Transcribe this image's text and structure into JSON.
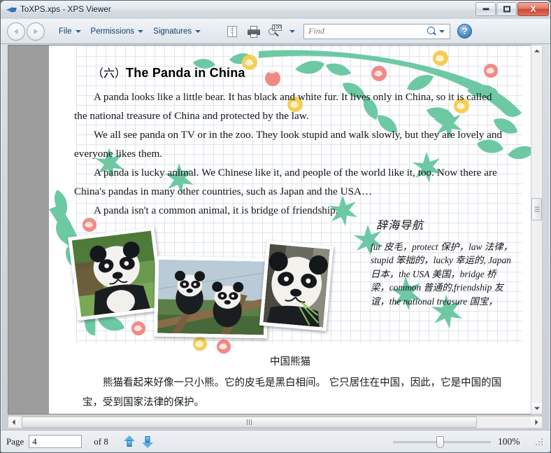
{
  "window": {
    "title": "ToXPS.xps - XPS Viewer",
    "app_icon": "xps-document-icon",
    "minimize_label": "Minimize",
    "maximize_label": "Maximize",
    "close_label": "X"
  },
  "toolbar": {
    "back_label": "Back",
    "forward_label": "Forward",
    "menus": [
      {
        "label": "File"
      },
      {
        "label": "Permissions"
      },
      {
        "label": "Signatures"
      }
    ],
    "layout_icon": "page-layout-icon",
    "print_icon": "printer-icon",
    "zoom_icon": "zoom-icon",
    "zoom_icon_value": "100",
    "find_placeholder": "Find",
    "find_value": "",
    "search_icon": "search-icon",
    "help_label": "?"
  },
  "document": {
    "heading_cn": "（六）",
    "heading_en": "The Panda in China",
    "paragraphs": [
      "A panda looks like a little bear. It has black and white fur. It lives only in China, so it is called the national treasure of China and protected by the law.",
      "We all see panda on TV or in the zoo. They look stupid and walk slowly, but they are lovely and everyone likes them.",
      "A panda is lucky animal. We Chinese like it, and people of the world like it, too. Now there are China's pandas in many other countries, such as Japan and the USA…",
      "A panda isn't a common animal, it is bridge of friendship."
    ],
    "vocabulary": {
      "title": "辞海导航",
      "entries": "fur 皮毛，protect 保护，law 法律，stupid 笨拙的，lucky 幸运的, Japan 日本，the USA 美国，bridge 桥梁，common 普通的,friendship 友谊，the national treasure 国宝，"
    },
    "photos": [
      {
        "caption": "young panda sitting on grass"
      },
      {
        "caption": "two pandas on a wooden frame"
      },
      {
        "caption": "giant panda eating bamboo"
      }
    ],
    "translation_title": "中国熊猫",
    "translation_body": "熊猫看起来好像一只小熊。它的皮毛是黑白相间。 它只居住在中国，因此，它是中国的国宝，受到国家法律的保护。"
  },
  "statusbar": {
    "page_label": "Page",
    "page_value": "4",
    "of_label": "of 8",
    "previous_page_label": "Previous page",
    "next_page_label": "Next page",
    "zoom_value": "100%"
  },
  "colors": {
    "accent_blue": "#2f6fae",
    "menu_text": "#12406e",
    "vine_green": "#6cc9a4",
    "flower_pink": "#f08a86",
    "flower_yellow": "#f5cf55",
    "grid_line": "#dfe5ec"
  }
}
